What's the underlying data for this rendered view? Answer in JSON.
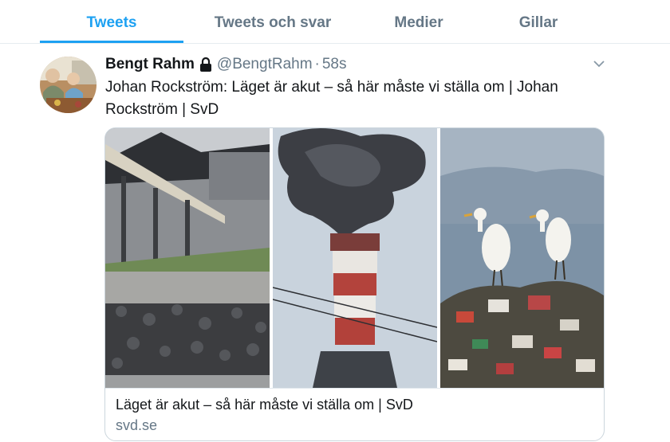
{
  "tabs": [
    {
      "label": "Tweets",
      "active": true
    },
    {
      "label": "Tweets och svar",
      "active": false
    },
    {
      "label": "Medier",
      "active": false
    },
    {
      "label": "Gillar",
      "active": false
    }
  ],
  "tweet": {
    "author_name": "Bengt Rahm",
    "handle": "@BengtRahm",
    "separator": "·",
    "time": "58s",
    "text": "Johan Rockström: Läget är akut – så här måste vi ställa om | Johan Rockström | SvD",
    "avatar_icon": "user-avatar",
    "lock_icon": "lock-icon",
    "menu_icon": "chevron-down-icon"
  },
  "card": {
    "images": [
      "coal-conveyor-photo",
      "smokestack-photo",
      "egrets-on-garbage-photo"
    ],
    "title": "Läget är akut – så här måste vi ställa om | SvD",
    "domain": "svd.se"
  },
  "colors": {
    "accent": "#1da1f2",
    "secondary_text": "#657786",
    "primary_text": "#14171a",
    "border": "#e6ecf0"
  }
}
